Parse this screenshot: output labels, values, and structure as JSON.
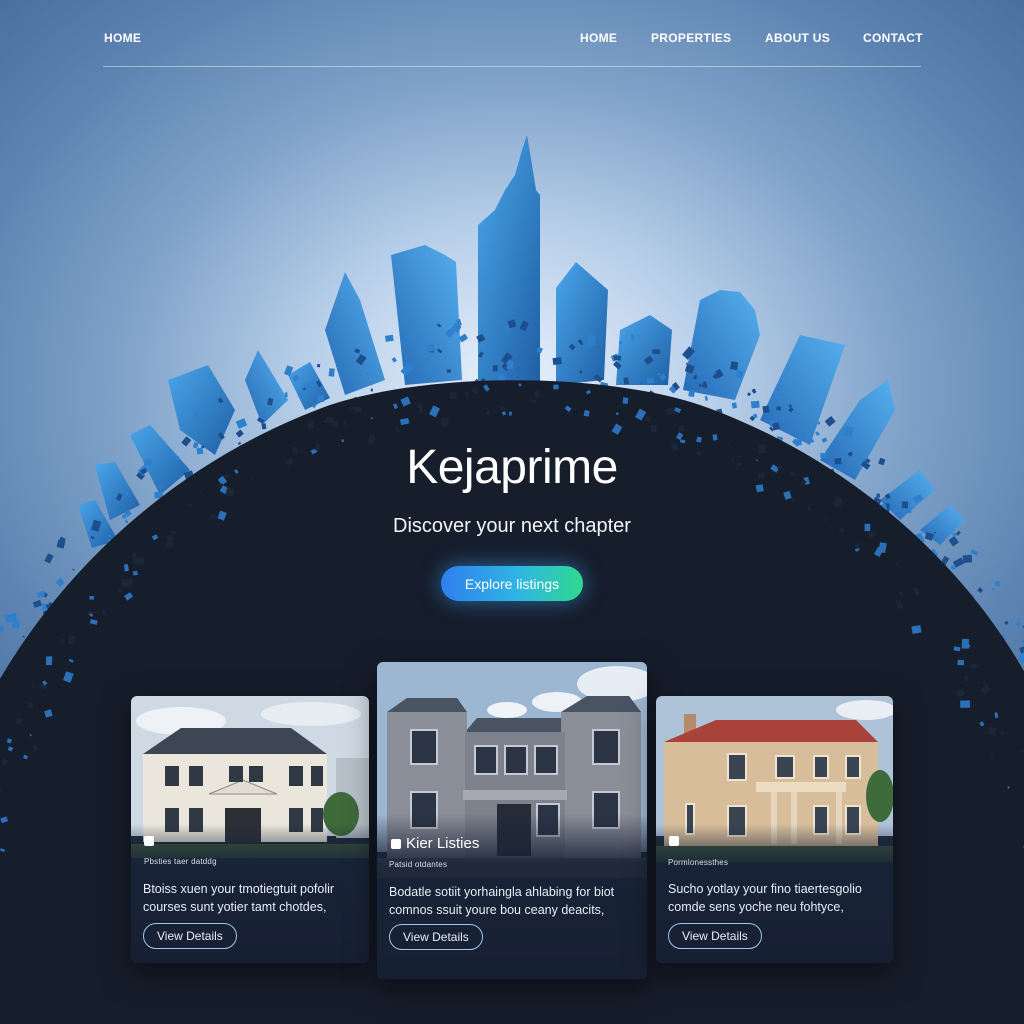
{
  "nav": {
    "brand": "HOME",
    "links": [
      "HOME",
      "PROPERTIES",
      "ABOUT US",
      "CONTACT"
    ]
  },
  "hero": {
    "title": "Kejaprime",
    "subtitle": "Discover your next chapter",
    "cta": "Explore listings"
  },
  "listings": [
    {
      "tag": "",
      "meta": "Pbsties taer datddg",
      "description": "Btoiss xuen your tmotiegtuit pofolir courses sunt yotier tamt chotdes,",
      "button": "View Details"
    },
    {
      "tag": "Kier Listies",
      "meta": "Patsid otdantes",
      "description": "Bodatle sotiit yorhaingla ahlabing for biot comnos ssuit youre bou ceany deacits,",
      "button": "View Details"
    },
    {
      "tag": "",
      "meta": "Pormlonessthes",
      "description": "Sucho yotlay your fino tiaertesgolio comde sens yoche neu fohtyce,",
      "button": "View Details"
    }
  ],
  "colors": {
    "accent_gradient_start": "#2f7ff0",
    "accent_gradient_end": "#2fd98f",
    "dark_navy": "#161d2b",
    "skyline_blue": "#3b8fd6"
  }
}
